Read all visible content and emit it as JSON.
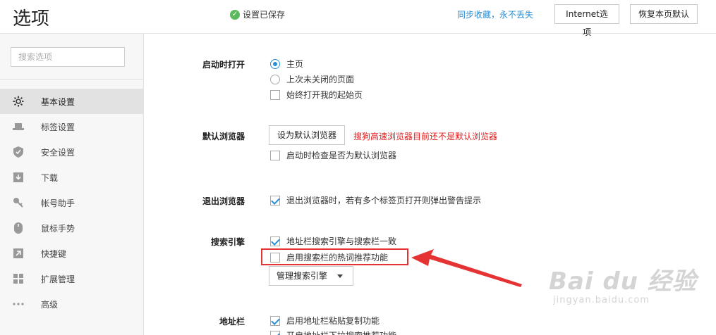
{
  "header": {
    "title": "选项",
    "saved_status": "设置已保存",
    "sync_link": "同步收藏，永不丢失",
    "internet_button": "Internet选项",
    "restore_button": "恢复本页默认"
  },
  "sidebar": {
    "search_placeholder": "搜索选项",
    "items": [
      {
        "label": "基本设置",
        "icon": "gear-icon",
        "active": true
      },
      {
        "label": "标签设置",
        "icon": "tab-icon"
      },
      {
        "label": "安全设置",
        "icon": "shield-icon"
      },
      {
        "label": "下载",
        "icon": "download-icon"
      },
      {
        "label": "帐号助手",
        "icon": "key-icon"
      },
      {
        "label": "鼠标手势",
        "icon": "mouse-icon"
      },
      {
        "label": "快捷键",
        "icon": "shortcut-arrow-icon"
      },
      {
        "label": "扩展管理",
        "icon": "extensions-grid-icon"
      },
      {
        "label": "高级",
        "icon": "more-dots-icon"
      }
    ]
  },
  "startup": {
    "label": "启动时打开",
    "options": [
      "主页",
      "上次未关闭的页面"
    ],
    "selected": "主页",
    "always_open_start": "始终打开我的起始页"
  },
  "default_browser": {
    "label": "默认浏览器",
    "set_default_button": "设为默认浏览器",
    "warning": "搜狗高速浏览器目前还不是默认浏览器",
    "check_on_start": "启动时检查是否为默认浏览器"
  },
  "exit": {
    "label": "退出浏览器",
    "warn_multi_tabs": "退出浏览器时，若有多个标签页打开则弹出警告提示"
  },
  "search_engine": {
    "label": "搜索引擎",
    "address_consistent": "地址栏搜索引擎与搜索栏一致",
    "hot_words": "启用搜索栏的热词推荐功能",
    "manage_button": "管理搜索引擎"
  },
  "address_bar": {
    "label": "地址栏",
    "paste_copy": "启用地址栏粘贴复制功能",
    "partial_next": "开启地址栏下拉搜索推荐功能"
  },
  "colors": {
    "accent": "#2a8fd6",
    "warning": "#e02020",
    "annotation": "#e53333"
  },
  "watermark": {
    "logo": "Bai du 经验",
    "url": "jingyan.baidu.com"
  }
}
